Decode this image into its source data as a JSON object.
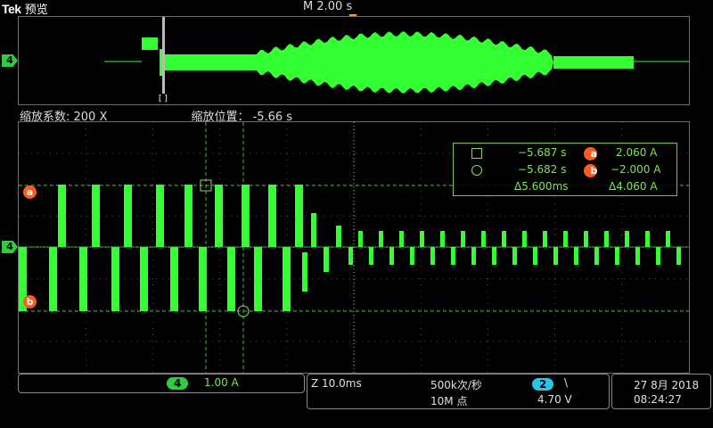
{
  "brand": {
    "logo": "Tek",
    "mode": "预览"
  },
  "timebase": "M 2.00 s",
  "zoom": {
    "factor_label": "缩放系数: 200 X",
    "position_label": "缩放位置：",
    "position_value": "-5.66 s"
  },
  "channel": {
    "number": "4",
    "scale": "1.00 A",
    "color": "#2ecc40"
  },
  "overview_cursor_label": "[ ]",
  "cursors": {
    "a_label": "a",
    "b_label": "b"
  },
  "readout": {
    "t1": "−5.687 s",
    "t2": "−5.682 s",
    "dt": "Δ5.600ms",
    "va": "2.060 A",
    "vb": "−2.000 A",
    "dv": "Δ4.060 A"
  },
  "acquisition": {
    "zoom_time": "Z 10.0ms",
    "sample_rate": "500k次/秒",
    "record_length": "10M 点",
    "trigger_channel": "2",
    "trigger_slope": "\\",
    "trigger_level": "4.70 V"
  },
  "datetime": {
    "date": "27 8月 2018",
    "time": "08:24:27"
  },
  "colors": {
    "trace": "#33ff33",
    "cursor_tag": "#ff5a1f",
    "trigger": "#f5a623",
    "trigger_ch": "#29c5e6"
  }
}
